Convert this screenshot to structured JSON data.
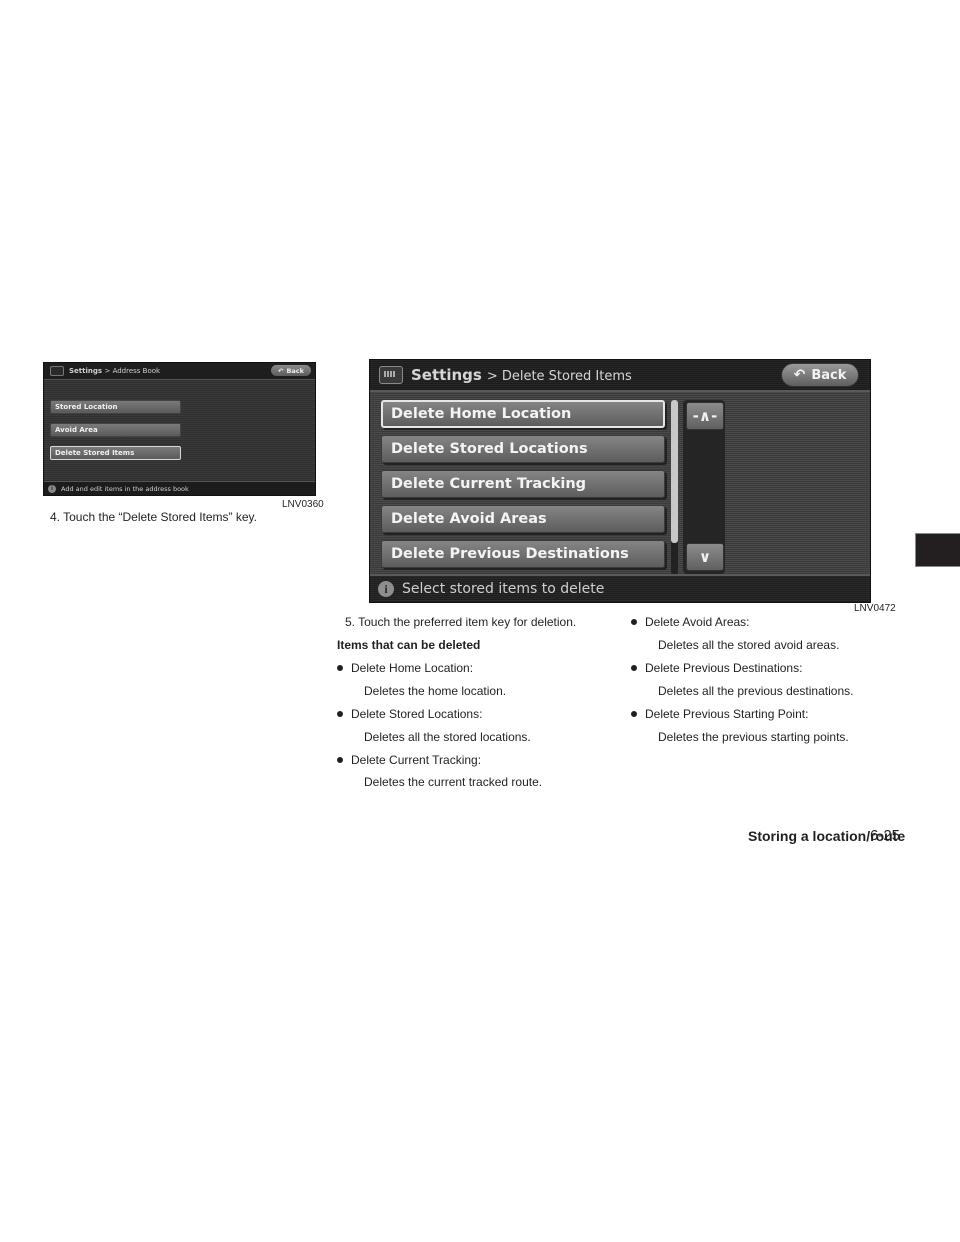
{
  "figure_small": {
    "label": "LNV0360",
    "header_title": "Settings",
    "header_sub": "> Address Book",
    "back_label": "Back",
    "keys": [
      "Stored Location",
      "Avoid Area",
      "Delete Stored Items"
    ],
    "selected_key": "Delete Stored Items",
    "footer_message": "Add and edit items in the address book"
  },
  "step4": "4. Touch the “Delete Stored Items” key.",
  "figure_large": {
    "label": "LNV0472",
    "header_title": "Settings",
    "header_sub": "> Delete Stored Items",
    "back_label": "Back",
    "back_icon": "↶",
    "keys": [
      "Delete Home Location",
      "Delete Stored Locations",
      "Delete Current Tracking",
      "Delete Avoid Areas",
      "Delete Previous Destinations"
    ],
    "selected_key": "Delete Home Location",
    "scroll_up_icon": "-∧-",
    "scroll_down_icon": "∨",
    "footer_message": "Select stored items to delete",
    "info_icon": "i"
  },
  "step5": "5. Touch the preferred item key for deletion.",
  "items_heading": "Items that can be deleted",
  "items": [
    {
      "title": "Delete Home Location:",
      "desc": "Deletes the home location."
    },
    {
      "title": "Delete Stored Locations:",
      "desc": "Deletes all the stored locations."
    },
    {
      "title": "Delete Current Tracking:",
      "desc": "Deletes the current tracked route."
    },
    {
      "title": "Delete Avoid Areas:",
      "desc": "Deletes all the stored avoid areas."
    },
    {
      "title": "Delete Previous Destinations:",
      "desc": "Deletes all the previous destinations."
    },
    {
      "title": "Delete Previous Starting Point:",
      "desc": "Deletes the previous starting points."
    }
  ],
  "footer": {
    "section": "Storing a location/route",
    "page": "6-25"
  }
}
